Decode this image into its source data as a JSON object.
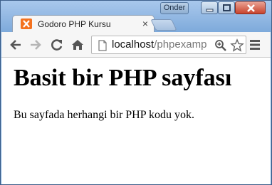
{
  "window": {
    "user_label": "Onder"
  },
  "tab": {
    "title": "Godoro PHP Kursu",
    "close_glyph": "×",
    "favicon": "xampp-icon"
  },
  "toolbar": {
    "url_host": "localhost",
    "url_path": "/phpexamp",
    "icons": [
      "back-arrow-icon",
      "forward-arrow-icon",
      "reload-icon",
      "home-icon",
      "page-icon",
      "zoom-icon",
      "star-icon",
      "menu-icon"
    ]
  },
  "page": {
    "heading": "Basit bir PHP sayfası",
    "paragraph": "Bu sayfada herhangi bir PHP kodu yok."
  },
  "colors": {
    "frame": "#6fa0d6",
    "favicon": "#f4721f",
    "close_button": "#c8432c"
  }
}
